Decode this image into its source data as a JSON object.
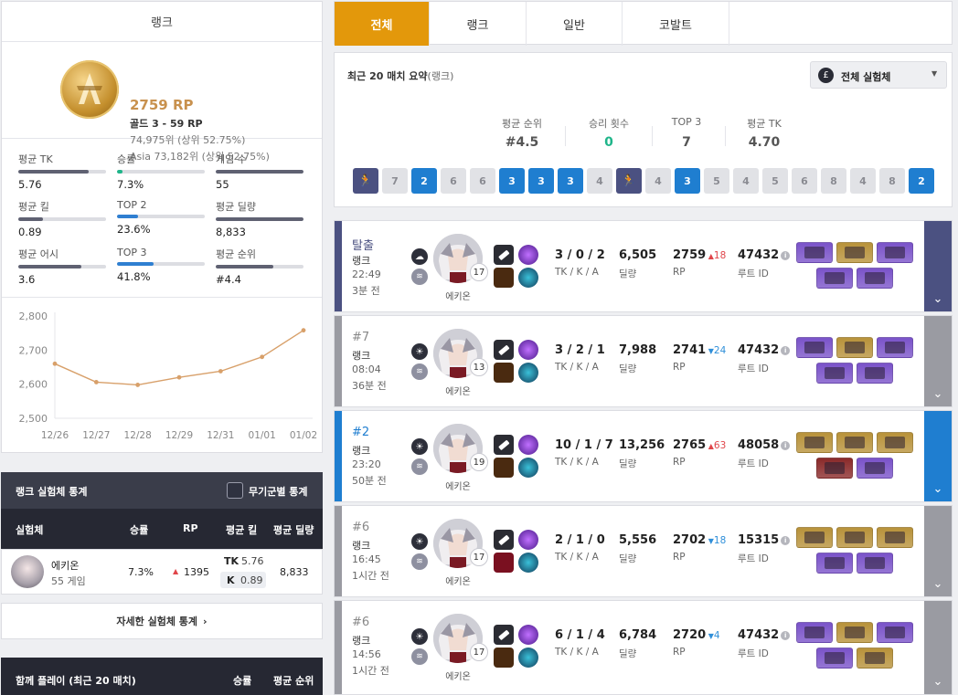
{
  "rank_card": {
    "title": "랭크",
    "rp": "2759 RP",
    "tier": "골드 3 - 59 RP",
    "global_rank": "74,975위 (상위 52.75%)",
    "region_rank": "Asia 73,182위 (상위 52.75%)",
    "stats": [
      {
        "label": "평균 TK",
        "value": "5.76",
        "fill": 0.8,
        "color": "#5f6172"
      },
      {
        "label": "승률",
        "value": "7.3%",
        "fill": 0.06,
        "color": "#1fb58a"
      },
      {
        "label": "게임 수",
        "value": "55",
        "fill": 1.0,
        "color": "#5f6172"
      },
      {
        "label": "평균 킬",
        "value": "0.89",
        "fill": 0.28,
        "color": "#5f6172"
      },
      {
        "label": "TOP 2",
        "value": "23.6%",
        "fill": 0.24,
        "color": "#2f7fd1"
      },
      {
        "label": "평균 딜량",
        "value": "8,833",
        "fill": 1.0,
        "color": "#5f6172"
      },
      {
        "label": "평균 어시",
        "value": "3.6",
        "fill": 0.72,
        "color": "#5f6172"
      },
      {
        "label": "TOP 3",
        "value": "41.8%",
        "fill": 0.42,
        "color": "#2f7fd1"
      },
      {
        "label": "평균 순위",
        "value": "#4.4",
        "fill": 0.66,
        "color": "#5f6172"
      }
    ]
  },
  "chart_data": {
    "type": "line",
    "x": [
      "12/26",
      "12/27",
      "12/28",
      "12/29",
      "12/31",
      "01/01",
      "01/02"
    ],
    "series": [
      {
        "values": [
          2660,
          2606,
          2598,
          2620,
          2638,
          2680,
          2758
        ]
      }
    ],
    "yticks": [
      "2,800",
      "2,700",
      "2,600",
      "2,500"
    ],
    "ylim": [
      2500,
      2800
    ],
    "line_color": "#d8a06a"
  },
  "champ_stats": {
    "title": "랭크 실험체 통계",
    "toggle_label": "무기군별 통계",
    "columns": [
      "실험체",
      "승률",
      "RP",
      "평균 킬",
      "평균 딜량"
    ],
    "row": {
      "name": "에키온",
      "games": "55 게임",
      "winrate": "7.3%",
      "rp": "1395",
      "tk_label": "TK",
      "tk": "5.76",
      "k_label": "K",
      "k": "0.89",
      "damage": "8,833"
    },
    "detail_link": "자세한 실험체 통계"
  },
  "together": {
    "title": "함께 플레이 (최근 20 매치)",
    "col1": "승률",
    "col2": "평균 순위"
  },
  "tabs": [
    "전체",
    "랭크",
    "일반",
    "코발트"
  ],
  "summary": {
    "title": "최근 20 매치 요약",
    "title_suffix": "(랭크)",
    "filter": "전체 실험체",
    "metrics": [
      {
        "label": "평균 순위",
        "value": "#4.5",
        "color": "#555"
      },
      {
        "label": "승리 횟수",
        "value": "0",
        "color": "#1fb58a"
      },
      {
        "label": "TOP 3",
        "value": "7",
        "color": "#555"
      },
      {
        "label": "평균 TK",
        "value": "4.70",
        "color": "#555"
      }
    ],
    "placements": [
      "run",
      "7",
      "2",
      "6",
      "6",
      "3",
      "3",
      "3",
      "4",
      "run",
      "4",
      "3",
      "5",
      "4",
      "5",
      "6",
      "8",
      "4",
      "8",
      "2"
    ]
  },
  "labels": {
    "tka": "TK / K / A",
    "damage": "딜량",
    "rp": "RP",
    "route": "루트 ID",
    "champ": "에키온"
  },
  "matches": [
    {
      "place": "탈출",
      "mode": "랭크",
      "time": "22:49",
      "ago": "3분 전",
      "level": "17",
      "kda": "3 / 0 / 2",
      "damage": "6,505",
      "rp": "2759",
      "delta": "18",
      "dir": "up",
      "route": "47432",
      "accent": "#4b5181",
      "place_color": "#4b5181"
    },
    {
      "place": "#7",
      "mode": "랭크",
      "time": "08:04",
      "ago": "36분 전",
      "level": "13",
      "kda": "3 / 2 / 1",
      "damage": "7,988",
      "rp": "2741",
      "delta": "24",
      "dir": "down",
      "route": "47432",
      "accent": "#9a9ba2",
      "place_color": "#888"
    },
    {
      "place": "#2",
      "mode": "랭크",
      "time": "23:20",
      "ago": "50분 전",
      "level": "19",
      "kda": "10 / 1 / 7",
      "damage": "13,256",
      "rp": "2765",
      "delta": "63",
      "dir": "up",
      "route": "48058",
      "accent": "#1f7ed0",
      "place_color": "#1f7ed0"
    },
    {
      "place": "#6",
      "mode": "랭크",
      "time": "16:45",
      "ago": "1시간 전",
      "level": "17",
      "kda": "2 / 1 / 0",
      "damage": "5,556",
      "rp": "2702",
      "delta": "18",
      "dir": "down",
      "route": "15315",
      "accent": "#9a9ba2",
      "place_color": "#888"
    },
    {
      "place": "#6",
      "mode": "랭크",
      "time": "14:56",
      "ago": "1시간 전",
      "level": "17",
      "kda": "6 / 1 / 4",
      "damage": "6,784",
      "rp": "2720",
      "delta": "4",
      "dir": "down",
      "route": "47432",
      "accent": "#9a9ba2",
      "place_color": "#888"
    }
  ]
}
